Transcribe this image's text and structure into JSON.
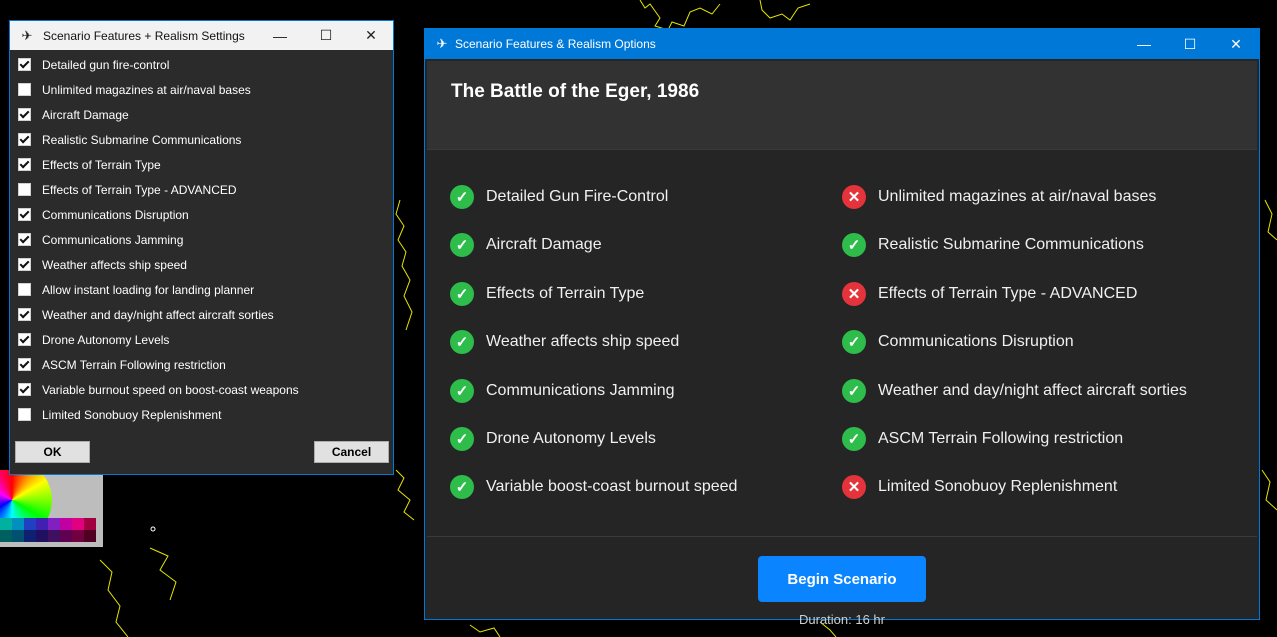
{
  "settings_window": {
    "title": "Scenario Features + Realism Settings",
    "options": [
      {
        "label": "Detailed gun fire-control",
        "checked": true
      },
      {
        "label": "Unlimited magazines at air/naval bases",
        "checked": false
      },
      {
        "label": "Aircraft Damage",
        "checked": true
      },
      {
        "label": "Realistic Submarine Communications",
        "checked": true
      },
      {
        "label": "Effects of Terrain Type",
        "checked": true
      },
      {
        "label": "Effects of Terrain Type - ADVANCED",
        "checked": false
      },
      {
        "label": "Communications Disruption",
        "checked": true
      },
      {
        "label": "Communications Jamming",
        "checked": true
      },
      {
        "label": "Weather affects ship speed",
        "checked": true
      },
      {
        "label": "Allow instant loading for landing planner",
        "checked": false
      },
      {
        "label": "Weather and day/night affect aircraft sorties",
        "checked": true
      },
      {
        "label": "Drone Autonomy Levels",
        "checked": true
      },
      {
        "label": "ASCM Terrain Following restriction",
        "checked": true
      },
      {
        "label": "Variable burnout speed on boost-coast weapons",
        "checked": true
      },
      {
        "label": "Limited Sonobuoy Replenishment",
        "checked": false
      }
    ],
    "ok_label": "OK",
    "cancel_label": "Cancel"
  },
  "options_window": {
    "title": "Scenario Features & Realism Options",
    "scenario_title": "The Battle of the Eger, 1986",
    "features_left": [
      {
        "label": "Detailed Gun Fire-Control",
        "enabled": true
      },
      {
        "label": "Aircraft Damage",
        "enabled": true
      },
      {
        "label": "Effects of Terrain Type",
        "enabled": true
      },
      {
        "label": "Weather affects ship speed",
        "enabled": true
      },
      {
        "label": "Communications Jamming",
        "enabled": true
      },
      {
        "label": "Drone Autonomy Levels",
        "enabled": true
      },
      {
        "label": "Variable boost-coast burnout speed",
        "enabled": true
      }
    ],
    "features_right": [
      {
        "label": "Unlimited magazines at air/naval bases",
        "enabled": false
      },
      {
        "label": "Realistic Submarine Communications",
        "enabled": true
      },
      {
        "label": "Effects of Terrain Type - ADVANCED",
        "enabled": false
      },
      {
        "label": "Communications Disruption",
        "enabled": true
      },
      {
        "label": "Weather and day/night affect aircraft sorties",
        "enabled": true
      },
      {
        "label": "ASCM Terrain Following restriction",
        "enabled": true
      },
      {
        "label": "Limited Sonobuoy Replenishment",
        "enabled": false
      }
    ],
    "begin_label": "Begin Scenario",
    "duration": "Duration: 16 hr"
  },
  "colors": {
    "accent": "#0078d7",
    "enabled": "#2ebd4b",
    "disabled": "#e5333b",
    "map_lines": "#ffff00"
  }
}
